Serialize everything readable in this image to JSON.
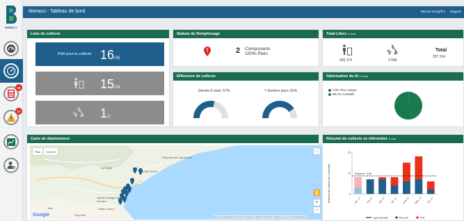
{
  "app": {
    "header_title": "Monaco - Tableau de bord",
    "user": "Werner Schopff ▾",
    "support": "Support",
    "logo_text": "BIGBELLY"
  },
  "sidebar": {
    "items": [
      {
        "icon": "gauge-icon",
        "badge": ""
      },
      {
        "icon": "dashboard-icon",
        "badge": "",
        "active": true
      },
      {
        "icon": "calculator-icon",
        "badge": "16"
      },
      {
        "icon": "warning-icon",
        "badge": "17"
      },
      {
        "icon": "chart-icon",
        "badge": ""
      },
      {
        "icon": "user-settings-icon",
        "badge": ""
      }
    ]
  },
  "liste_collecte": {
    "title": "Liste de collecte",
    "tiles": [
      {
        "label": "Prêt pour la collecte",
        "value": "16",
        "total": "/26",
        "icon": "",
        "color": "#1f5f8b"
      },
      {
        "label": "",
        "value": "15",
        "total": "/24",
        "icon": "trash-person-icon",
        "color": "#8c8c8c"
      },
      {
        "label": "",
        "value": "1",
        "total": "/2",
        "icon": "recycle-icon",
        "color": "#8c8c8c"
      }
    ]
  },
  "statuts": {
    "title": "Statuts de Remplissage",
    "count": "2",
    "line1": "Composants",
    "line2": "100% Plein"
  },
  "total_liters": {
    "title": "Total Liters",
    "subtitle": "/ 6 mois",
    "trash_value": "255 174",
    "recycle_value": "2 040",
    "total_label": "Total",
    "total_value": "257 214"
  },
  "efficience": {
    "title": "Efficience de collecte",
    "left_label": "Dernier 6 mois: 57%",
    "left_value": 57,
    "right_label": "7 derniers jours: 81%",
    "right_value": 81
  },
  "valorisation": {
    "title": "Valorisation du tri",
    "subtitle": "/ 6 mois",
    "legend": [
      {
        "label": "0.8% Flux unique",
        "color": "#1f5f8b"
      },
      {
        "label": "99.2% Corbeille",
        "color": "#1a7a4f"
      }
    ],
    "pie": [
      0.8,
      99.2
    ]
  },
  "carte": {
    "title": "Carte de déploiement",
    "tab_plan": "Plan",
    "tab_satellite": "Satellite",
    "places": [
      "La Turbie",
      "Gimelli Forum",
      "Jardin Exotique de Monaco",
      "Stade Louis II",
      "Eze",
      "Cap-d'Ail",
      "Roquebrune-Cap-Martin"
    ],
    "google": "Google",
    "footer": "Données cartographiques ©2017 Google   Conditions d'utilisation   Signaler une erreur cartographique"
  },
  "resume": {
    "title": "Résumé de collecte vs référentiel",
    "subtitle": "/ 6 mois",
    "average_label": "Moyenne : 8.65",
    "ylabel": "Moyenne de collecte par composant",
    "legend": [
      {
        "label": "Ligne de base",
        "color": "#1a7a4f"
      },
      {
        "label": "Pas prêt",
        "color": "#1f5f8b"
      },
      {
        "label": "Prêt",
        "color": "#e8321b"
      }
    ]
  },
  "chart_data": {
    "type": "bar",
    "title": "Résumé de collecte vs référentiel",
    "ylabel": "Moyenne de collecte par composant",
    "categories": [
      "avr. 17",
      "mai 17",
      "juin 17",
      "juil. 17",
      "août 17",
      "sept. 17",
      "oct. 17"
    ],
    "series": [
      {
        "name": "Pas prêt",
        "values": [
          3,
          7,
          7,
          4,
          6,
          7,
          2
        ]
      },
      {
        "name": "Prêt",
        "values": [
          5,
          0,
          1,
          4,
          9,
          11,
          4
        ]
      }
    ],
    "average": 8.65,
    "ylim": [
      0,
      20
    ],
    "yticks": [
      0,
      10,
      20
    ]
  }
}
